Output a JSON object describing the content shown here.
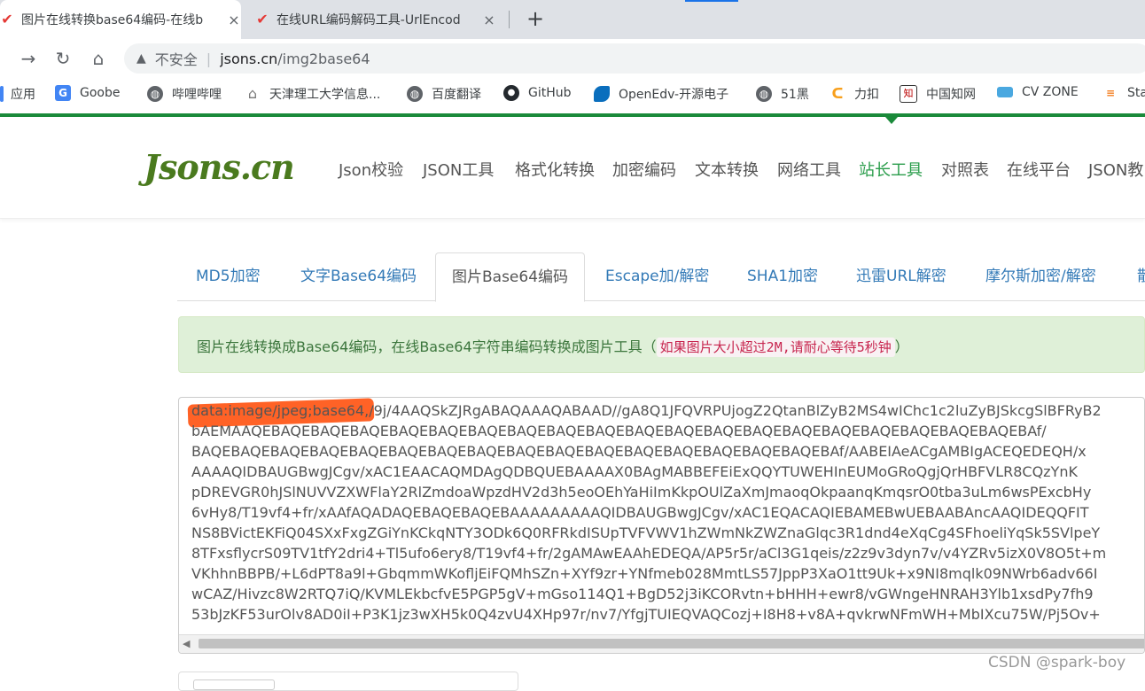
{
  "browser": {
    "tabs": [
      {
        "title": "图片在线转换base64编码-在线b",
        "active": true
      },
      {
        "title": "在线URL编码解码工具-UrlEncod",
        "active": false
      }
    ],
    "new_tab": "+",
    "close": "×",
    "address": {
      "security": "不安全",
      "host": "jsons.cn",
      "path": "/img2base64"
    },
    "bookmarks": [
      {
        "label": "应用",
        "icon": "apps-icon"
      },
      {
        "label": "Goobe",
        "icon": "google-translate-icon"
      },
      {
        "label": "哔哩哔哩",
        "icon": "globe-icon"
      },
      {
        "label": "天津理工大学信息...",
        "icon": "home-icon"
      },
      {
        "label": "百度翻译",
        "icon": "globe-icon"
      },
      {
        "label": "GitHub",
        "icon": "github-icon"
      },
      {
        "label": "OpenEdv-开源电子",
        "icon": "openedv-icon"
      },
      {
        "label": "51黑",
        "icon": "globe-icon"
      },
      {
        "label": "力扣",
        "icon": "leetcode-icon"
      },
      {
        "label": "中国知网",
        "icon": "cnki-icon"
      },
      {
        "label": "CV ZONE",
        "icon": "cvzone-icon"
      },
      {
        "label": "Sta",
        "icon": "stack-icon"
      }
    ]
  },
  "site": {
    "logo": "Jsons.cn",
    "nav": [
      "Json校验",
      "JSON工具",
      "格式化转换",
      "加密编码",
      "文本转换",
      "网络工具",
      "站长工具",
      "对照表",
      "在线平台",
      "JSON教"
    ],
    "nav_active": "站长工具",
    "accent_color": "#2a9d4b"
  },
  "tool_tabs": [
    "MD5加密",
    "文字Base64编码",
    "图片Base64编码",
    "Escape加/解密",
    "SHA1加密",
    "迅雷URL解密",
    "摩尔斯加密/解密",
    "散"
  ],
  "tool_tab_active": "图片Base64编码",
  "alert": {
    "text": "图片在线转换成Base64编码，在线Base64字符串编码转换成图片工具（",
    "note": "如果图片大小超过2M,请耐心等待5秒钟",
    "close_paren": "）"
  },
  "base64": {
    "prefix": "data:image/jpeg;base64,",
    "lines": [
      "/9j/4AAQSkZJRgABAQAAAQABAAD//gA8Q1JFQVRPUjogZ2QtanBlZyB2MS4wIChc1c2luZyBJSkcgSlBFRyB2",
      "bAEMAAQEBAQEBAQEBAQEBAQEBAQEBAQEBAQEBAQEBAQEBAQEBAQEBAQEBAQEBAQEBAQEBAQEBAQEBAQEBAQEBAf/",
      "BAQEBAQEBAQEBAQEBAQEBAQEBAQEBAQEBAQEBAQEBAQEBAQEBAQEBAQEBAQEBAQEBAf/AABEIAeACgAMBIgACEQEDEQH/x",
      "AAAAQIDBAUGBwgJCgv/xAC1EAACAQMDAgQDBQUEBAAAAX0BAgMABBEFEiExQQYTUWEHInEUMoGRoQgjQrHBFVLR8CQzYnK",
      "pDREVGR0hJSlNUVVZXWFlaY2RlZmdoaWpzdHV2d3h5eoOEhYaHiImKkpOUlZaXmJmaoqOkpaanqKmqsrO0tba3uLm6wsPExcbHy",
      "6vHy8/T19vf4+fr/xAAfAQADAQEBAQEBAQEBAAAAAAAAAQIDBAUGBwgJCgv/xAC1EQACAQIEBAMEBwUEBAABAncAAQIDEQQFIT",
      "NS8BVictEKFiQ04SXxFxgZGiYnKCkqNTY3ODk6Q0RFRkdISUpTVFVWV1hZWmNkZWZnaGlqc3R1dnd4eXqCg4SFhoeliYqSk5SVlpeY",
      "8TFxsflycrS09TV1tfY2dri4+Tl5ufo6ery8/T19vf4+fr/2gAMAwEAAhEDEQA/AP5r5r/aCl3G1qeis/z2z9v3dyn7v/v4YZRv5izX0V8O5t+m",
      "VKhhnBBPB/+L6dPT8a9l+GbqmmWKofljEiFQMhSZn+XYf9zr+YNfmeb028MmtLS57JppP3XaO1tt9Uk+x9NI8mqlk09NWrb6adv66I",
      "wCAZ/Hivzc8W2RTQ7iQ/KVMLEkbcfvE5PGP5gV+mGso114Q1+BgD52j3iKCORvtn+bHHH+ewr8/vGWngeHNRAH3Ylb1xsdPy7fh9",
      "53bJzKF53urOlv8AD0iI+P3K1jz3wXH5k0Q4zvU4XHp97r/nv7/YfgjTUIEQVAQCozj+I8H8+v8A+qvkrwNFmWH+MbIXcu75W/Pj5Ov+"
    ]
  },
  "watermark": "CSDN @spark-boy"
}
